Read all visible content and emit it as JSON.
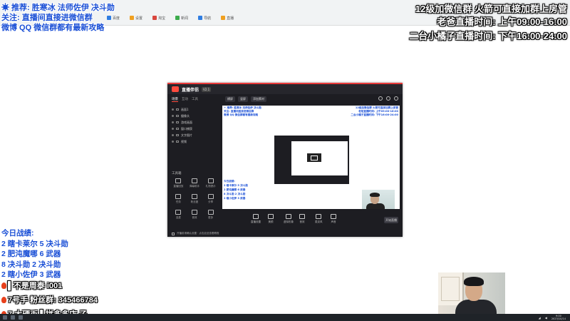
{
  "overlay": {
    "top_left": [
      "☀ 推荐: 胜寒冰 法师佐伊 决斗勋",
      "关注: 直播间直接进微信群",
      "微博 QQ 微信群都有最新攻略"
    ],
    "top_right": [
      "12级加微信群 火箭可直接加群上房管",
      "老爸直播时间: 上午09:00-16:00",
      "二台小橘子直播时间: 下午16:00-24:00"
    ],
    "record_title": "今日战绩:",
    "record_rows": [
      "2 瞎卡莱尔 5 决斗勋",
      "2 肥沌魔哪 6 武器",
      "8 决斗勋 2 决斗勋",
      "2 瞎小佐伊 3 武器"
    ],
    "promo": [
      "▌不是周泰 i001",
      "7号手 粉丝群: 345466784",
      "7 大硬币 ▌拼多多店 子"
    ]
  },
  "browser": {
    "bookmarks": [
      "百度",
      "设置",
      "淘宝",
      "新闻",
      "导航",
      "直播"
    ]
  },
  "app": {
    "logo": "直播伴侣",
    "version": "V2.1",
    "tabs": [
      "场景",
      "互动",
      "工具"
    ],
    "scenes": [
      "画面1",
      "摄像头",
      "游戏画面",
      "窗口捕获",
      "文字图片",
      "视频"
    ],
    "tools_label": "工具箱",
    "tools": [
      "直播回放",
      "弹幕助手",
      "礼物提示",
      "任务",
      "粉丝团",
      "分享",
      "连麦",
      "音效",
      "更多"
    ],
    "toolbar_chips": [
      "横屏",
      "竖屏",
      "添加素材"
    ],
    "controls": [
      "直播设置",
      "美颜",
      "虚拟形象",
      "音效",
      "麦克风",
      "声音"
    ],
    "go_live": "开始直播",
    "status_text": "开播前请确认设置 · 点击此处查看教程"
  },
  "taskbar": {
    "time": "9:00",
    "date": "2023/10/14"
  }
}
